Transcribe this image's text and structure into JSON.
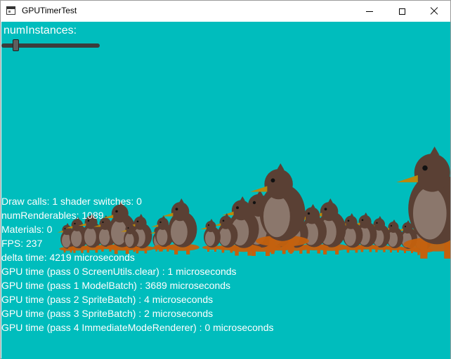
{
  "window": {
    "title": "GPUTimerTest",
    "app_icon": "window-app-icon",
    "controls": [
      "minimize-icon",
      "maximize-icon",
      "close-icon"
    ]
  },
  "colors": {
    "viewport_bg": "#00bdbd",
    "text": "#ffffff",
    "penguin_body": "#5a4034",
    "penguin_belly": "#e8e0d8",
    "penguin_feet": "#c4610e"
  },
  "slider": {
    "label": "numInstances:",
    "value_fraction": 0.12
  },
  "stats": {
    "lines": [
      "Draw calls: 1 shader switches: 0",
      "numRenderables: 1089",
      "Materials: 0",
      "FPS: 237",
      "delta time: 4219 microseconds",
      "GPU time (pass 0 ScreenUtils.clear) : 1 microseconds",
      "GPU time (pass 1 ModelBatch) : 3689 microseconds",
      "GPU time (pass 2 SpriteBatch) : 4 microseconds",
      "GPU time (pass 3 SpriteBatch) : 2 microseconds",
      "GPU time (pass 4 ImmediateModeRenderer) : 0 microseconds"
    ]
  }
}
